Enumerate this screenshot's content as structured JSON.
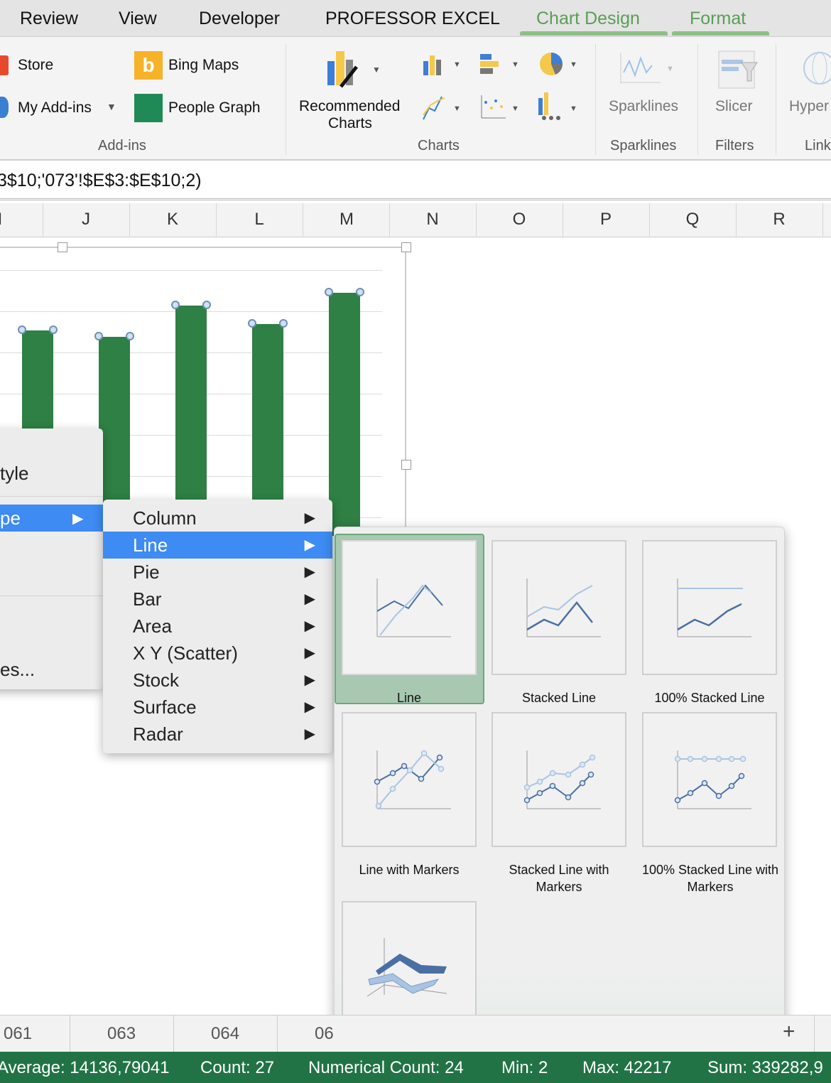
{
  "tabs": {
    "review": "Review",
    "view": "View",
    "developer": "Developer",
    "professor": "PROFESSOR EXCEL",
    "chart_design": "Chart Design",
    "format": "Format"
  },
  "ribbon": {
    "store": "Store",
    "my_addins": "My Add-ins",
    "bing_maps": "Bing Maps",
    "people_graph": "People Graph",
    "addins_group": "Add-ins",
    "recommended_1": "Recommended",
    "recommended_2": "Charts",
    "charts_group": "Charts",
    "sparklines": "Sparklines",
    "sparklines_group": "Sparklines",
    "slicer": "Slicer",
    "filters_group": "Filters",
    "hyperlink": "Hyper",
    "links_group": "Link"
  },
  "formula": "3$10;'073'!$E$3:$E$10;2)",
  "columns": [
    "I",
    "J",
    "K",
    "L",
    "M",
    "N",
    "O",
    "P",
    "Q",
    "R"
  ],
  "chart": {
    "bar_color": "#2e8044",
    "values": [
      0.78,
      0.76,
      0.86,
      0.8,
      0.9
    ]
  },
  "context_menu": {
    "items": [
      "tyle",
      "pe",
      "es..."
    ]
  },
  "submenu": {
    "items": [
      "Column",
      "Line",
      "Pie",
      "Bar",
      "Area",
      "X Y (Scatter)",
      "Stock",
      "Surface",
      "Radar"
    ],
    "selected": "Line"
  },
  "gallery": {
    "items": [
      "Line",
      "Stacked Line",
      "100% Stacked Line",
      "Line with Markers",
      "Stacked Line with Markers",
      "100% Stacked Line with Markers",
      "3-D Line"
    ],
    "selected": "Line"
  },
  "sheet_tabs": [
    "061",
    "063",
    "064",
    "06"
  ],
  "add_sheet": "+",
  "status": {
    "average": "Average: 14136,79041",
    "count": "Count: 27",
    "numerical_count": "Numerical Count: 24",
    "min": "Min: 2",
    "max": "Max: 42217",
    "sum": "Sum: 339282,9"
  },
  "colors": {
    "accent": "#217346",
    "highlight": "#3d8bf3",
    "context_tab": "#5a9e55"
  }
}
